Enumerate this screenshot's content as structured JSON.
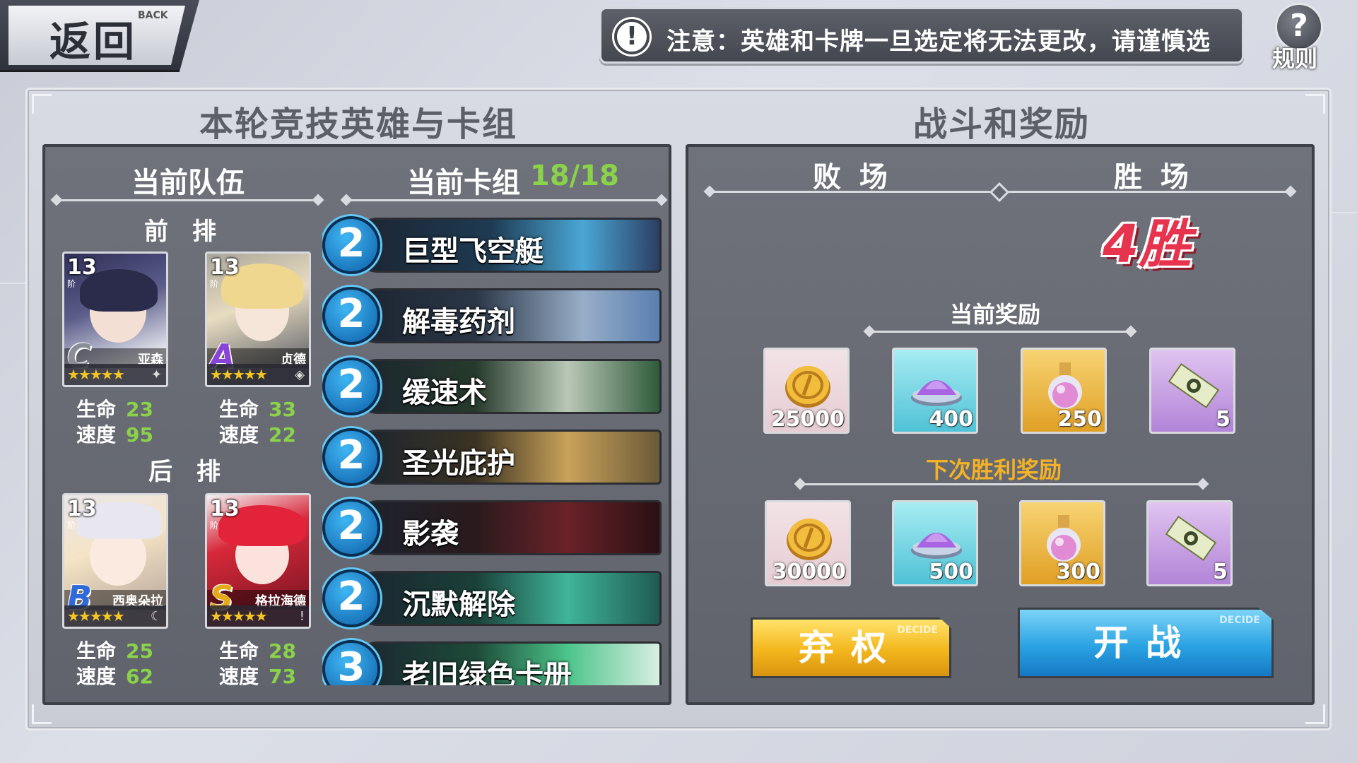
{
  "back": {
    "label": "返回",
    "sub": "BACK"
  },
  "notice": {
    "icon": "exclamation-icon",
    "text": "注意：英雄和卡牌一旦选定将无法更改，请谨慎选"
  },
  "rules": {
    "icon": "question-icon",
    "label": "规则"
  },
  "left": {
    "title": "本轮竞技英雄与卡组",
    "team_header": "当前队伍",
    "deck_header": "当前卡组",
    "deck_count": "18/18",
    "front_label": "前排",
    "back_label": "后排",
    "heroes": [
      {
        "level": "13",
        "level_sub": "阶",
        "rank": "C",
        "name": "亚森",
        "stars": "★★★★★",
        "hp_label": "生命",
        "hp": "23",
        "spd_label": "速度",
        "spd": "95",
        "rank_color": "#8b8e98"
      },
      {
        "level": "13",
        "level_sub": "阶",
        "rank": "A",
        "name": "贞德",
        "stars": "★★★★★",
        "hp_label": "生命",
        "hp": "33",
        "spd_label": "速度",
        "spd": "22",
        "rank_color": "#8a43d8"
      },
      {
        "level": "13",
        "level_sub": "阶",
        "rank": "B",
        "name": "西奥朵拉",
        "stars": "★★★★★",
        "hp_label": "生命",
        "hp": "25",
        "spd_label": "速度",
        "spd": "62",
        "rank_color": "#2f6ad8"
      },
      {
        "level": "13",
        "level_sub": "阶",
        "rank": "S",
        "name": "格拉海德",
        "stars": "★★★★★",
        "hp_label": "生命",
        "hp": "28",
        "spd_label": "速度",
        "spd": "73",
        "rank_color": "#e5a91c"
      }
    ],
    "deck": [
      {
        "cost": "2",
        "name": "巨型飞空艇"
      },
      {
        "cost": "2",
        "name": "解毒药剂"
      },
      {
        "cost": "2",
        "name": "缓速术"
      },
      {
        "cost": "2",
        "name": "圣光庇护"
      },
      {
        "cost": "2",
        "name": "影袭"
      },
      {
        "cost": "2",
        "name": "沉默解除"
      },
      {
        "cost": "3",
        "name": "老旧绿色卡册"
      }
    ]
  },
  "right": {
    "title": "战斗和奖励",
    "loss_header": "败 场",
    "win_header": "胜 场",
    "wins": "4胜",
    "current_reward_title": "当前奖励",
    "next_reward_title": "下次胜利奖励",
    "current_rewards": [
      {
        "icon": "gold-coin-icon",
        "value": "25000"
      },
      {
        "icon": "purple-dust-icon",
        "value": "400"
      },
      {
        "icon": "potion-icon",
        "value": "250"
      },
      {
        "icon": "ticket-icon",
        "value": "5"
      }
    ],
    "next_rewards": [
      {
        "icon": "gold-coin-icon",
        "value": "30000"
      },
      {
        "icon": "purple-dust-icon",
        "value": "500"
      },
      {
        "icon": "potion-icon",
        "value": "300"
      },
      {
        "icon": "ticket-icon",
        "value": "5"
      }
    ],
    "forfeit_label": "弃权",
    "fight_label": "开战",
    "decide_tag": "DECIDE"
  }
}
